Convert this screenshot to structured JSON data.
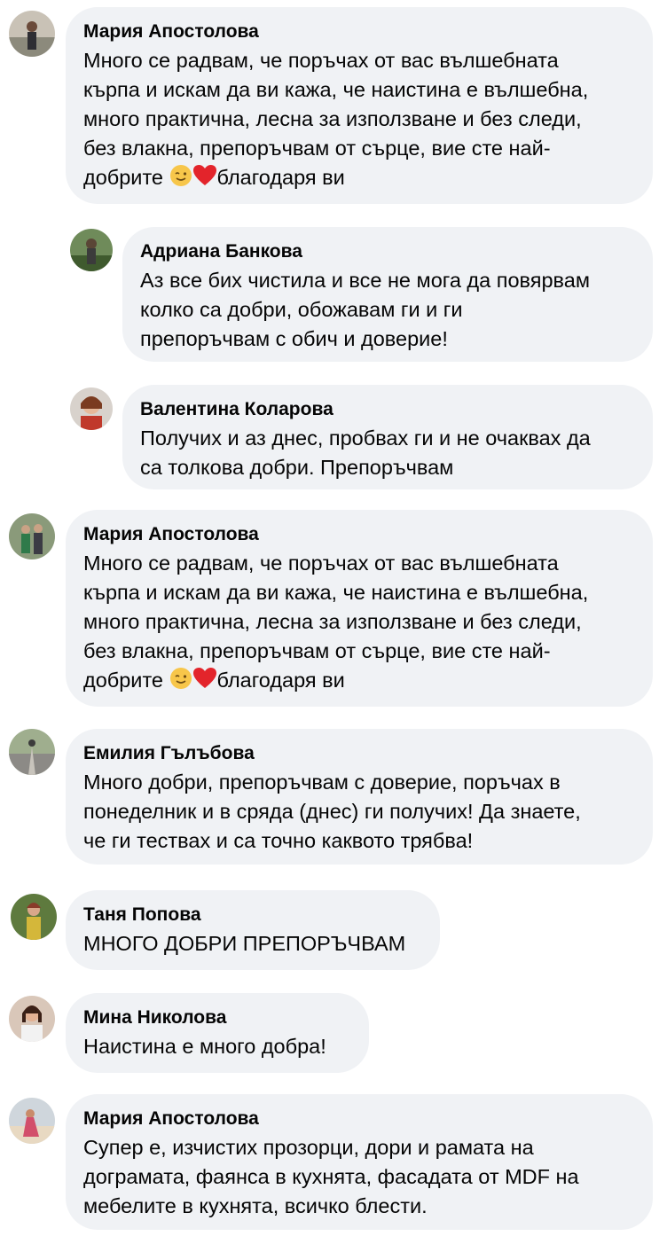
{
  "comments": [
    {
      "name": "Мария Апостолова",
      "lines": [
        "Много се радвам, че поръчах от вас вълшебната",
        "кърпа и искам да ви кажа, че наистина е вълшебна,",
        "много практична, лесна за използване и без следи,",
        "без влакна, препоръчвам от сърце, вие сте най-"
      ],
      "last_prefix": "добрите ",
      "last_suffix": "благодаря ви",
      "emoji": [
        "winking-face",
        "red-heart"
      ]
    },
    {
      "name": "Адриана Банкова",
      "lines": [
        "Аз все бих чистила и все не мога да повярвам",
        "колко са добри, обожавам ги и ги",
        "препоръчвам с обич и доверие!"
      ]
    },
    {
      "name": "Валентина Коларова",
      "lines": [
        "Получих и аз днес, пробвах ги и не очаквах да",
        "са толкова добри. Препоръчвам"
      ]
    },
    {
      "name": "Мария Апостолова",
      "lines": [
        "Много се радвам, че поръчах от вас вълшебната",
        "кърпа и искам да ви кажа, че наистина е вълшебна,",
        "много практична, лесна за използване и без следи,",
        "без влакна, препоръчвам от сърце, вие сте най-"
      ],
      "last_prefix": "добрите ",
      "last_suffix": "благодаря ви",
      "emoji": [
        "winking-face",
        "red-heart"
      ]
    },
    {
      "name": "Емилия Гълъбова",
      "lines": [
        "Много добри, препоръчвам с доверие, поръчах в",
        "понеделник и в сряда (днес) ги получих! Да знаете,",
        "че ги тествах и са точно каквото трябва!"
      ]
    },
    {
      "name": "Таня Попова",
      "lines": [
        "МНОГО ДОБРИ ПРЕПОРЪЧВАМ"
      ]
    },
    {
      "name": "Мина Николова",
      "lines": [
        "Наистина е много добра!"
      ]
    },
    {
      "name": "Мария Апостолова",
      "lines": [
        "Супер е, изчистих прозорци, дори и рамата на",
        "дограмата, фаянса в кухнята, фасадата от MDF на",
        "мебелите в кухнята, всичко блести."
      ]
    }
  ],
  "colors": {
    "bubble": "#f0f2f5",
    "text": "#050505"
  }
}
